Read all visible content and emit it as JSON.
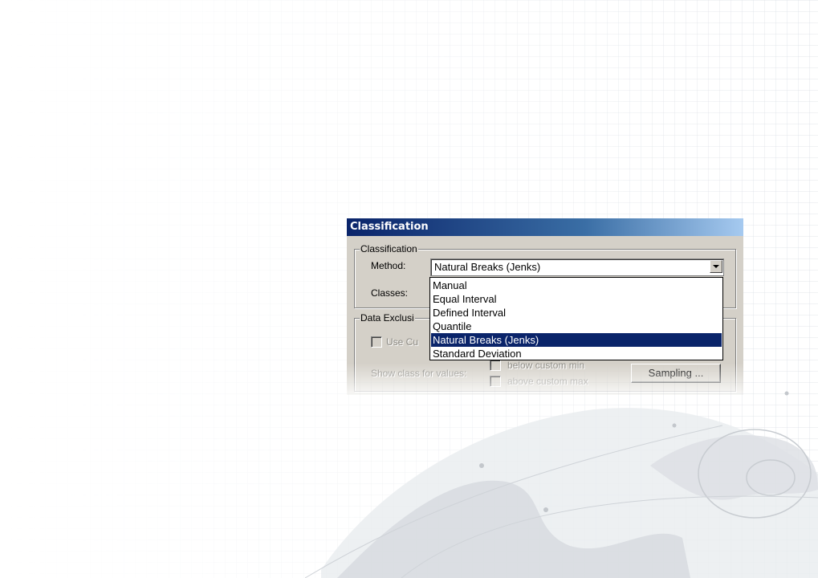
{
  "window": {
    "title": "Classification"
  },
  "classification_group": {
    "legend": "Classification",
    "method_label": "Method:",
    "method_value": "Natural Breaks (Jenks)",
    "classes_label": "Classes:"
  },
  "method_options": [
    {
      "label": "Manual",
      "selected": false
    },
    {
      "label": "Equal Interval",
      "selected": false
    },
    {
      "label": "Defined Interval",
      "selected": false
    },
    {
      "label": "Quantile",
      "selected": false
    },
    {
      "label": "Natural Breaks (Jenks)",
      "selected": true
    },
    {
      "label": "Standard Deviation",
      "selected": false
    }
  ],
  "exclusion_group": {
    "legend": "Data Exclusi",
    "use_custom_label": "Use Cu",
    "show_class_label": "Show class for values:",
    "below_min_label": "below custom min",
    "above_max_label": "above custom max",
    "sampling_button": "Sampling ..."
  },
  "colors": {
    "title_bar_start": "#0a246a",
    "title_bar_end": "#a6caf0",
    "dialog_face": "#d4d0c8",
    "selection": "#0a246a"
  }
}
